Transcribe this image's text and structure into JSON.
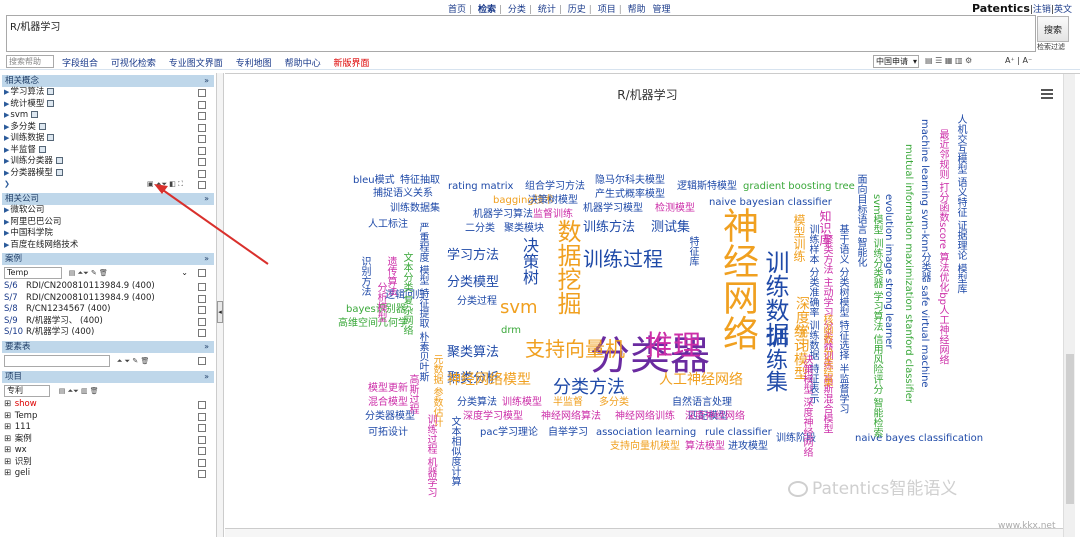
{
  "topnav": {
    "items": [
      "首页",
      "检索",
      "分类",
      "统计",
      "历史",
      "项目",
      "帮助",
      "管理"
    ],
    "brand": "Patentics",
    "logout": "注销",
    "lang": "英文"
  },
  "search": {
    "query": "R/机器学习",
    "button": "搜索",
    "filter": "检索过滤"
  },
  "toolbar": {
    "help_placeholder": "搜索帮助",
    "links": [
      "字段组合",
      "可视化检索",
      "专业图文界面",
      "专利地图",
      "帮助中心"
    ],
    "new_ui": "新版界面",
    "country": "中国申请",
    "font_big": "A⁺",
    "font_small": "A⁻"
  },
  "sidebar": {
    "concepts": {
      "title": "相关概念",
      "items": [
        "学习算法",
        "统计模型",
        "svm",
        "多分类",
        "训练数据",
        "半监督",
        "训练分类器",
        "分类器模型"
      ]
    },
    "companies": {
      "title": "相关公司",
      "items": [
        "微软公司",
        "阿里巴巴公司",
        "中国科学院",
        "百度在线网络技术"
      ]
    },
    "cases": {
      "title": "案例",
      "select": "Temp",
      "items": [
        {
          "key": "S/6",
          "label": "RDI/CN200810113984.9 (400)"
        },
        {
          "key": "S/7",
          "label": "RDI/CN200810113984.9 (400)"
        },
        {
          "key": "S/8",
          "label": "R/CN1234567 (400)"
        },
        {
          "key": "S/9",
          "label": "R/机器学习、 (400)"
        },
        {
          "key": "S/10",
          "label": "R/机器学习 (400)"
        }
      ]
    },
    "elements": {
      "title": "要素表"
    },
    "projects": {
      "title": "项目",
      "select": "专利",
      "items": [
        "show",
        "Temp",
        "111",
        "案例",
        "wx",
        "识别",
        "geli"
      ]
    }
  },
  "main": {
    "chart_title": "R/机器学习"
  },
  "chart_data": {
    "type": "wordcloud",
    "title": "R/机器学习",
    "words": [
      {
        "text": "分类器",
        "color": "#6a2ba0"
      },
      {
        "text": "神经网络",
        "color": "#f0a020"
      },
      {
        "text": "训练数据",
        "color": "#1f4aa8"
      },
      {
        "text": "训练集",
        "color": "#1f4aa8"
      },
      {
        "text": "推理",
        "color": "#cc2ea8"
      },
      {
        "text": "数据挖掘",
        "color": "#f0a020"
      },
      {
        "text": "训练过程",
        "color": "#1f4aa8"
      },
      {
        "text": "支持向量机",
        "color": "#f0a020"
      },
      {
        "text": "分类方法",
        "color": "#1f4aa8"
      },
      {
        "text": "svm",
        "color": "#f0a020"
      },
      {
        "text": "学习方法",
        "color": "#1f4aa8"
      },
      {
        "text": "分类模型",
        "color": "#1f4aa8"
      },
      {
        "text": "决策树",
        "color": "#1f4aa8"
      },
      {
        "text": "训练方法",
        "color": "#1f4aa8"
      },
      {
        "text": "测试集",
        "color": "#1f4aa8"
      },
      {
        "text": "聚类算法",
        "color": "#1f4aa8"
      },
      {
        "text": "聚类分析",
        "color": "#1f4aa8"
      },
      {
        "text": "神经网络模型",
        "color": "#f0a020"
      },
      {
        "text": "人工神经网络",
        "color": "#f0a020"
      },
      {
        "text": "统计模型",
        "color": "#f0a020"
      },
      {
        "text": "深度学习",
        "color": "#f0a020"
      },
      {
        "text": "模型训练",
        "color": "#f0a020"
      },
      {
        "text": "知识库",
        "color": "#cc2ea8"
      },
      {
        "text": "bleu模式",
        "color": "#1f4aa8"
      },
      {
        "text": "特征抽取",
        "color": "#1f4aa8"
      },
      {
        "text": "捕捉语义关系",
        "color": "#1f4aa8"
      },
      {
        "text": "训练数据集",
        "color": "#1f4aa8"
      },
      {
        "text": "人工标注",
        "color": "#1f4aa8"
      },
      {
        "text": "rating matrix",
        "color": "#1f4aa8"
      },
      {
        "text": "组合学习方法",
        "color": "#1f4aa8"
      },
      {
        "text": "隐马尔科夫模型",
        "color": "#1f4aa8"
      },
      {
        "text": "产生式概率模型",
        "color": "#1f4aa8"
      },
      {
        "text": "逻辑斯特模型",
        "color": "#1f4aa8"
      },
      {
        "text": "gradient boosting tree",
        "color": "#3aa83a"
      },
      {
        "text": "naive bayesian classifier",
        "color": "#1f4aa8"
      },
      {
        "text": "bagging技术",
        "color": "#f0a020"
      },
      {
        "text": "决策树模型",
        "color": "#1f4aa8"
      },
      {
        "text": "机器学习算法",
        "color": "#1f4aa8"
      },
      {
        "text": "监督训练",
        "color": "#cc2ea8"
      },
      {
        "text": "机器学习模型",
        "color": "#1f4aa8"
      },
      {
        "text": "检测模型",
        "color": "#cc2ea8"
      },
      {
        "text": "二分类",
        "color": "#1f4aa8"
      },
      {
        "text": "聚类模块",
        "color": "#1f4aa8"
      },
      {
        "text": "分类过程",
        "color": "#1f4aa8"
      },
      {
        "text": "drm",
        "color": "#3aa83a"
      },
      {
        "text": "bayes识别器",
        "color": "#3aa83a"
      },
      {
        "text": "高维空间几何学",
        "color": "#3aa83a"
      },
      {
        "text": "逻辑回归",
        "color": "#1f4aa8"
      },
      {
        "text": "模型更新",
        "color": "#cc2ea8"
      },
      {
        "text": "混合模型",
        "color": "#cc2ea8"
      },
      {
        "text": "分类器模型",
        "color": "#1f4aa8"
      },
      {
        "text": "分类算法",
        "color": "#1f4aa8"
      },
      {
        "text": "训练模型",
        "color": "#cc2ea8"
      },
      {
        "text": "半监督",
        "color": "#f0a020"
      },
      {
        "text": "多分类",
        "color": "#f0a020"
      },
      {
        "text": "自然语言处理",
        "color": "#1f4aa8"
      },
      {
        "text": "匹配模型",
        "color": "#1f4aa8"
      },
      {
        "text": "深度学习模型",
        "color": "#cc2ea8"
      },
      {
        "text": "神经网络算法",
        "color": "#cc2ea8"
      },
      {
        "text": "神经网络训练",
        "color": "#cc2ea8"
      },
      {
        "text": "深度神经网络",
        "color": "#cc2ea8"
      },
      {
        "text": "可拓设计",
        "color": "#1f4aa8"
      },
      {
        "text": "pac学习理论",
        "color": "#1f4aa8"
      },
      {
        "text": "自举学习",
        "color": "#1f4aa8"
      },
      {
        "text": "association learning",
        "color": "#1f4aa8"
      },
      {
        "text": "rule classifier",
        "color": "#1f4aa8"
      },
      {
        "text": "支持向量机模型",
        "color": "#f0a020"
      },
      {
        "text": "算法模型",
        "color": "#cc2ea8"
      },
      {
        "text": "进攻模型",
        "color": "#1f4aa8"
      },
      {
        "text": "训练阶段",
        "color": "#1f4aa8"
      },
      {
        "text": "naive bayes classification",
        "color": "#1f4aa8"
      },
      {
        "text": "evolution image strong learner",
        "color": "#1f4aa8"
      },
      {
        "text": "mutual information maximization stanford classifier",
        "color": "#3aa83a"
      },
      {
        "text": "machine learning svm-knn分类器 safe virtual machine",
        "color": "#1f4aa8"
      },
      {
        "text": "最近邻规则 打分函数score 算法优化bp人工神经网络",
        "color": "#cc2ea8"
      },
      {
        "text": "人机交互模型 语义特征 证据理论 模型库",
        "color": "#1f4aa8"
      },
      {
        "text": "面向目标语言 智能化",
        "color": "#1f4aa8"
      },
      {
        "text": "svm模型 训练分类器 学习算法 信用风险评分 智能检索",
        "color": "#3aa83a"
      },
      {
        "text": "基于语义 分类树模型 特征选择 半监督学习",
        "color": "#1f4aa8"
      },
      {
        "text": "聚类方法 主动学习 分类器训练 高斯混合模型",
        "color": "#cc2ea8"
      },
      {
        "text": "训练样本 分类准确率 训练数据 特征表示",
        "color": "#1f4aa8"
      },
      {
        "text": "核函数 分类结果",
        "color": "#f0a020"
      },
      {
        "text": "严重程度 模型 特征提取 朴素贝叶斯",
        "color": "#1f4aa8"
      },
      {
        "text": "文本分类 复杂网络",
        "color": "#3aa83a"
      },
      {
        "text": "识别方法",
        "color": "#1f4aa8"
      },
      {
        "text": "遗传算法",
        "color": "#cc2ea8"
      },
      {
        "text": "元数据 参数估计",
        "color": "#f0a020"
      },
      {
        "text": "分析模型",
        "color": "#cc2ea8"
      },
      {
        "text": "训练过程 机器学习",
        "color": "#cc2ea8"
      },
      {
        "text": "文本相似度计算",
        "color": "#1f4aa8"
      },
      {
        "text": "高斯过程",
        "color": "#cc2ea8"
      },
      {
        "text": "特征库",
        "color": "#1f4aa8"
      },
      {
        "text": "决策模型 深度神经网络",
        "color": "#cc2ea8"
      }
    ]
  },
  "watermark": {
    "text": "Patentics智能语义",
    "site": "www.kkx.net"
  }
}
